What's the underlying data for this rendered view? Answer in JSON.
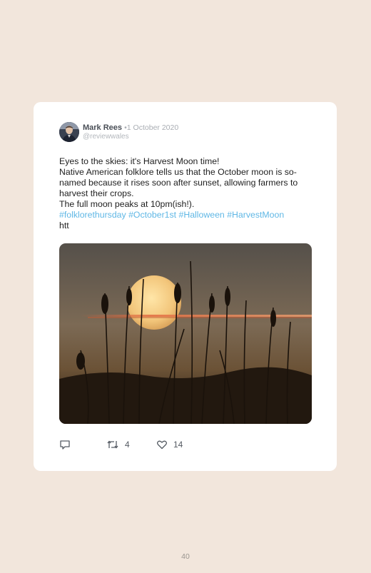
{
  "tweet": {
    "author_name": "Mark Rees",
    "separator": "•",
    "date": "1 October 2020",
    "handle": "@reviewwales",
    "lines": [
      "Eyes to the skies: it's Harvest Moon time!",
      "Native American folklore tells us that the October moon is so-named because it rises soon after sunset, allowing farmers to harvest their crops.",
      "The full moon peaks at 10pm(ish!)."
    ],
    "hashtags": [
      "#folklorethursday",
      "#October1st",
      "#Halloween",
      "#HarvestMoon"
    ],
    "truncated": "htt",
    "image_icon": "harvest-moon-photo",
    "retweet_count": "4",
    "like_count": "14"
  },
  "icons": {
    "reply": "reply-icon",
    "retweet": "retweet-icon",
    "like": "heart-icon"
  },
  "colors": {
    "page_background": "#f2e6dc",
    "card": "#ffffff",
    "hashtag": "#5fb7e5"
  },
  "page_number": "40"
}
